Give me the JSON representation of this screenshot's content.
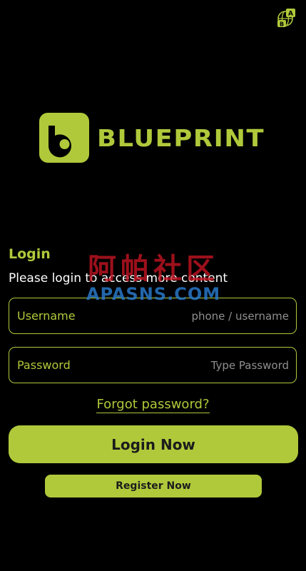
{
  "header": {
    "language_icon": "language-switch-icon"
  },
  "brand": {
    "name": "BLUEPRINT",
    "color": "#b0c93b"
  },
  "login": {
    "title": "Login",
    "subtitle": "Please login to access more content"
  },
  "fields": {
    "username": {
      "label": "Username",
      "placeholder": "phone / username",
      "value": ""
    },
    "password": {
      "label": "Password",
      "placeholder": "Type Password",
      "value": ""
    }
  },
  "links": {
    "forgot_password": "Forgot password?"
  },
  "buttons": {
    "login": "Login Now",
    "register": "Register Now"
  },
  "watermark": {
    "cn": "阿帕社区",
    "en": "APASNS.COM"
  }
}
